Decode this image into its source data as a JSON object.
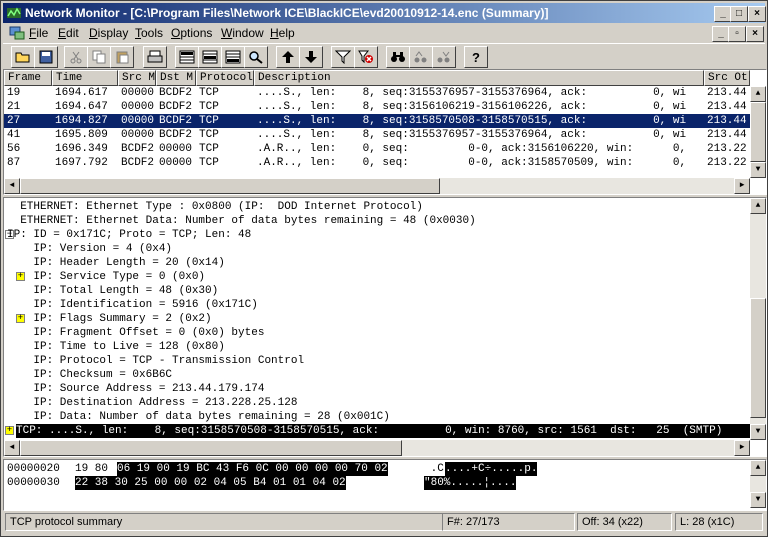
{
  "window": {
    "title": "Network Monitor - [C:\\Program Files\\Network ICE\\BlackICE\\evd20010912-14.enc (Summary)]",
    "controls": [
      "_",
      "□",
      "×"
    ]
  },
  "menu": {
    "items": [
      {
        "pre": "",
        "ul": "F",
        "post": "ile"
      },
      {
        "pre": "",
        "ul": "E",
        "post": "dit"
      },
      {
        "pre": "",
        "ul": "D",
        "post": "isplay"
      },
      {
        "pre": "",
        "ul": "T",
        "post": "ools"
      },
      {
        "pre": "",
        "ul": "O",
        "post": "ptions"
      },
      {
        "pre": "",
        "ul": "W",
        "post": "indow"
      },
      {
        "pre": "",
        "ul": "H",
        "post": "elp"
      }
    ],
    "mdi_controls": [
      "_",
      "▫",
      "×"
    ]
  },
  "toolbar": {
    "help_label": "?"
  },
  "summary": {
    "columns": [
      "Frame",
      "Time",
      "Src MAC",
      "Dst MAC",
      "Protocol",
      "Description",
      "Src Other"
    ],
    "column_titles": [
      "Frame",
      "Time",
      "Src M",
      "Dst M",
      "Protocol",
      "Description",
      "Src Ot"
    ],
    "rows": [
      {
        "frame": "19",
        "time": "1694.617",
        "src": "00000",
        "dst": "BCDF2",
        "proto": "TCP",
        "desc": "....S., len:    8, seq:3155376957-3155376964, ack:          0, wi",
        "other": "213.44"
      },
      {
        "frame": "21",
        "time": "1694.647",
        "src": "00000",
        "dst": "BCDF2",
        "proto": "TCP",
        "desc": "....S., len:    8, seq:3156106219-3156106226, ack:          0, wi",
        "other": "213.44"
      },
      {
        "frame": "27",
        "time": "1694.827",
        "src": "00000",
        "dst": "BCDF2",
        "proto": "TCP",
        "desc": "....S., len:    8, seq:3158570508-3158570515, ack:          0, wi",
        "other": "213.44",
        "selected": true
      },
      {
        "frame": "41",
        "time": "1695.809",
        "src": "00000",
        "dst": "BCDF2",
        "proto": "TCP",
        "desc": "....S., len:    8, seq:3155376957-3155376964, ack:          0, wi",
        "other": "213.44"
      },
      {
        "frame": "56",
        "time": "1696.349",
        "src": "BCDF2",
        "dst": "00000",
        "proto": "TCP",
        "desc": ".A.R.., len:    0, seq:         0-0, ack:3156106220, win:      0,",
        "other": "213.22"
      },
      {
        "frame": "87",
        "time": "1697.792",
        "src": "BCDF2",
        "dst": "00000",
        "proto": "TCP",
        "desc": ".A.R.., len:    0, seq:         0-0, ack:3158570509, win:      0,",
        "other": "213.22"
      }
    ]
  },
  "detail": {
    "lines": [
      {
        "text": "  ETHERNET: Ethernet Type : 0x0800 (IP:  DOD Internet Protocol)",
        "expander": ""
      },
      {
        "text": "  ETHERNET: Ethernet Data: Number of data bytes remaining = 48 (0x0030)",
        "expander": ""
      },
      {
        "text": "IP: ID = 0x171C; Proto = TCP; Len: 48",
        "expander": "-"
      },
      {
        "text": "    IP: Version = 4 (0x4)",
        "expander": ""
      },
      {
        "text": "    IP: Header Length = 20 (0x14)",
        "expander": ""
      },
      {
        "text": "    IP: Service Type = 0 (0x0)",
        "expander": "+"
      },
      {
        "text": "    IP: Total Length = 48 (0x30)",
        "expander": ""
      },
      {
        "text": "    IP: Identification = 5916 (0x171C)",
        "expander": ""
      },
      {
        "text": "    IP: Flags Summary = 2 (0x2)",
        "expander": "+"
      },
      {
        "text": "    IP: Fragment Offset = 0 (0x0) bytes",
        "expander": ""
      },
      {
        "text": "    IP: Time to Live = 128 (0x80)",
        "expander": ""
      },
      {
        "text": "    IP: Protocol = TCP - Transmission Control",
        "expander": ""
      },
      {
        "text": "    IP: Checksum = 0x6B6C",
        "expander": ""
      },
      {
        "text": "    IP: Source Address = 213.44.179.174",
        "expander": ""
      },
      {
        "text": "    IP: Destination Address = 213.228.25.128",
        "expander": ""
      },
      {
        "text": "    IP: Data: Number of data bytes remaining = 28 (0x001C)",
        "expander": ""
      },
      {
        "text": "TCP: ....S., len:    8, seq:3158570508-3158570515, ack:          0, win: 8760, src: 1561  dst:   25  (SMTP)",
        "expander": "+",
        "selected": true
      }
    ]
  },
  "hex": {
    "lines": [
      {
        "offset": "00000020",
        "plain_bytes": "19 80",
        "hl_bytes": "06 19 00 19 BC 43 F6 0C 00 00 00 00 70 02",
        "plain_ascii": " .C",
        "hl_ascii": "....+C÷.....p."
      },
      {
        "offset": "00000030",
        "plain_bytes": "",
        "hl_bytes": "22 38 30 25 00 00 02 04 05 B4 01 01 04 02",
        "plain_ascii": "",
        "hl_ascii": "\"80%.....¦...."
      }
    ]
  },
  "status": {
    "summary": "TCP protocol summary",
    "frame": "F#: 27/173",
    "offset": "Off: 34 (x22)",
    "length": "L: 28 (x1C)"
  }
}
